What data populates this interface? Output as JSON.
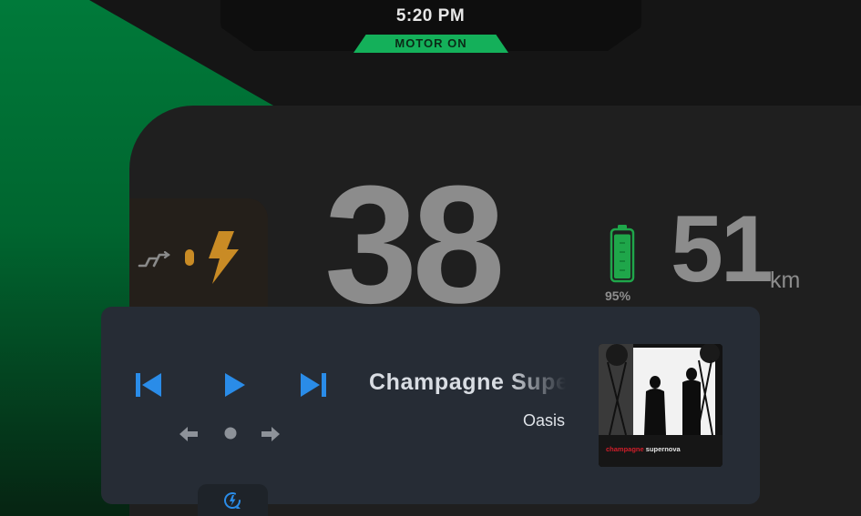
{
  "status_bar": {
    "time": "5:20 PM",
    "motor_status": "MOTOR ON"
  },
  "dashboard": {
    "speed": "38",
    "battery_percent": "95%",
    "battery_level": 0.95,
    "range_value": "51",
    "range_unit": "km",
    "ride_mode_icons": [
      "gear-shift-icon",
      "indicator-dot-icon",
      "lightning-bolt-icon"
    ]
  },
  "media_player": {
    "track_title": "Champagne Supernova",
    "artist": "Oasis",
    "album_art_text": "champagne supernova",
    "controls": [
      "previous-track-icon",
      "play-icon",
      "next-track-icon"
    ],
    "nav_controls": [
      "arrow-left-icon",
      "center-dot-icon",
      "arrow-right-icon"
    ]
  },
  "bottom_tab": {
    "icon": "charge-mode-icon"
  },
  "colors": {
    "accent_green": "#14b05a",
    "wedge_green": "#007a3a",
    "control_blue": "#2a8ce8",
    "bolt_amber": "#c98b25",
    "battery_green": "#1fa64a"
  }
}
